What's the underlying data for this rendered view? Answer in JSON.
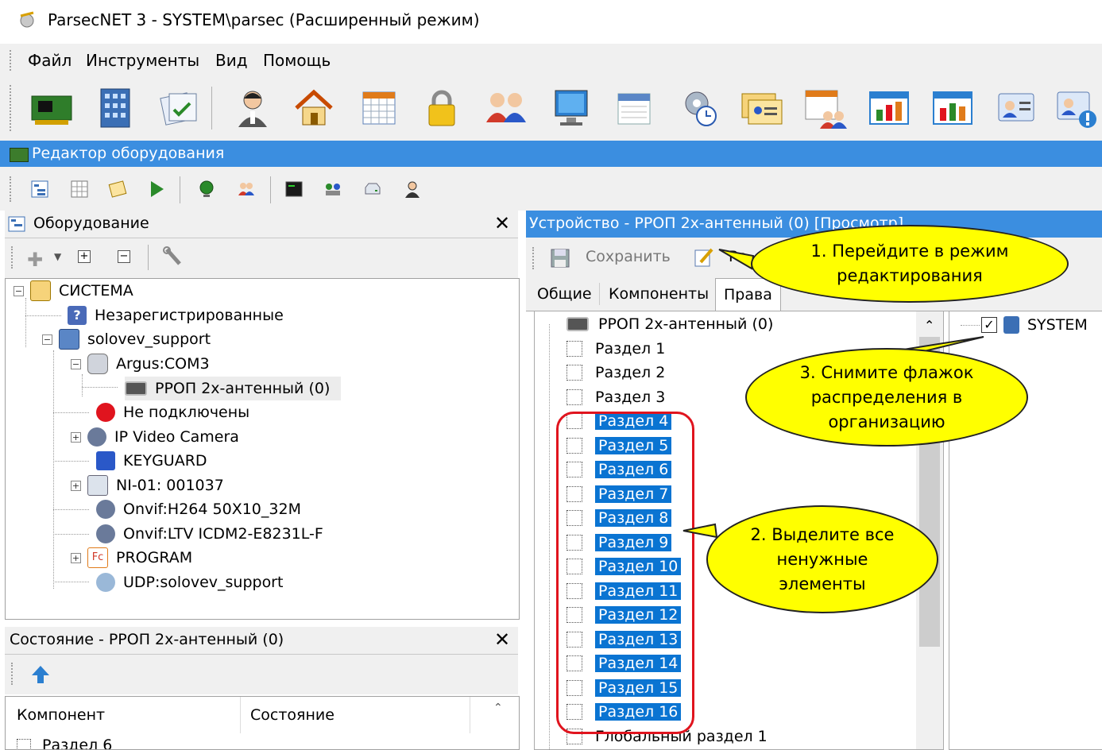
{
  "window": {
    "title": "ParsecNET 3 - SYSTEM\\parsec (Расширенный режим)"
  },
  "menu": [
    "Файл",
    "Инструменты",
    "Вид",
    "Помощь"
  ],
  "toolbar_icons": [
    "hardware-icon",
    "building-icon",
    "documents-icon",
    "person-icon",
    "home-icon",
    "calendar-grid-icon",
    "lock-icon",
    "users-icon",
    "monitor-icon",
    "schedule-icon",
    "gear-clock-icon",
    "cards-icon",
    "group-table-icon",
    "chart-icon",
    "chart2-icon",
    "id-card-icon",
    "id-card-alert-icon"
  ],
  "editor_bar": {
    "title": "Редактор оборудования"
  },
  "left_panel": {
    "title": "Оборудование",
    "tree": [
      {
        "label": "СИСТЕМА"
      },
      {
        "label": "Незарегистрированные"
      },
      {
        "label": "solovev_support"
      },
      {
        "label": "Argus:COM3"
      },
      {
        "label": "РРОП 2х-антенный (0)"
      },
      {
        "label": "Не подключены"
      },
      {
        "label": "IP Video Camera"
      },
      {
        "label": "KEYGUARD"
      },
      {
        "label": "NI-01: 001037"
      },
      {
        "label": "Onvif:H264 50X10_32M"
      },
      {
        "label": "Onvif:LTV ICDM2-E8231L-F"
      },
      {
        "label": "PROGRAM"
      },
      {
        "label": "UDP:solovev_support"
      }
    ]
  },
  "status_panel": {
    "title": "Состояние - РРОП 2х-антенный (0)",
    "col_component": "Компонент",
    "col_state": "Состояние",
    "row1": "Раздел 6"
  },
  "right_panel": {
    "title": "Устройство - РРОП 2х-антенный (0) [Просмотр]",
    "save": "Сохранить",
    "edit_partial": "Ре",
    "tabs": [
      "Общие",
      "Компоненты",
      "Права"
    ],
    "device": "РРОП 2х-антенный (0)",
    "sections": [
      "Раздел 1",
      "Раздел 2",
      "Раздел 3",
      "Раздел 4",
      "Раздел 5",
      "Раздел 6",
      "Раздел 7",
      "Раздел 8",
      "Раздел 9",
      "Раздел 10",
      "Раздел 11",
      "Раздел 12",
      "Раздел 13",
      "Раздел 14",
      "Раздел 15",
      "Раздел 16"
    ],
    "global": "Глобальный раздел 1",
    "org": "SYSTEM"
  },
  "callouts": {
    "c1": "1. Перейдите в режим редактирования",
    "c2": "2. Выделите все ненужные элементы",
    "c3": "3. Снимите флажок распределения в организацию"
  },
  "colors": {
    "selection": "#0a74d2",
    "titlebar_blue": "#3b8ee0",
    "callout": "#ffff00",
    "highlight_border": "#e0141e"
  }
}
